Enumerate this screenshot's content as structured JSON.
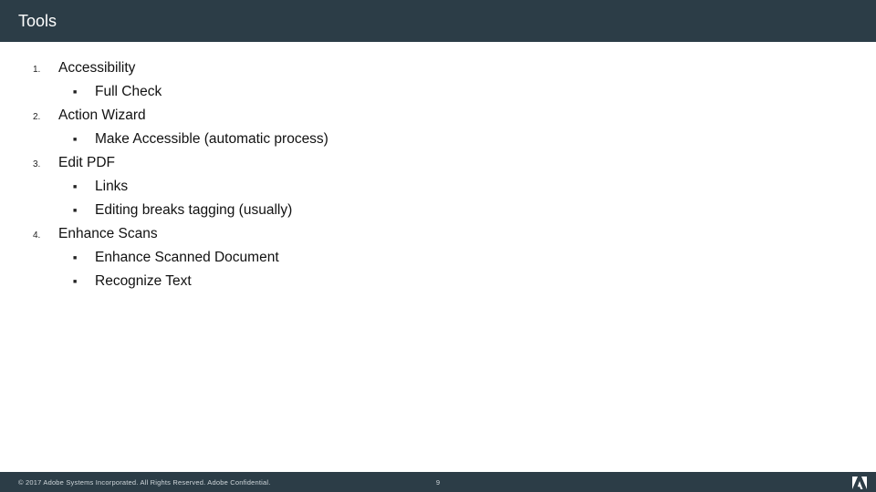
{
  "title": "Tools",
  "items": [
    {
      "num": "1.",
      "label": "Accessibility",
      "sub": [
        "Full Check"
      ]
    },
    {
      "num": "2.",
      "label": "Action Wizard",
      "sub": [
        "Make Accessible (automatic process)"
      ]
    },
    {
      "num": "3.",
      "label": "Edit PDF",
      "sub": [
        "Links",
        "Editing breaks tagging (usually)"
      ]
    },
    {
      "num": "4.",
      "label": "Enhance Scans",
      "sub": [
        "Enhance Scanned Document",
        "Recognize Text"
      ]
    }
  ],
  "footer": {
    "copyright": "© 2017 Adobe Systems Incorporated.  All Rights Reserved.  Adobe Confidential.",
    "page": "9"
  }
}
